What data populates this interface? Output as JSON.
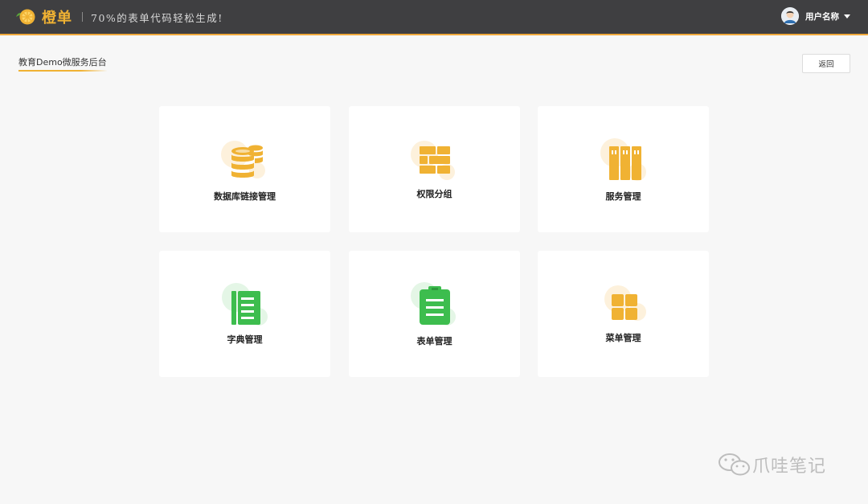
{
  "header": {
    "logo_text": "橙单",
    "slogan": "70%的表单代码轻松生成!",
    "user_name": "用户名称"
  },
  "page": {
    "title": "教育Demo微服务后台",
    "back_label": "返回"
  },
  "cards": [
    {
      "label": "数据库链接管理",
      "icon": "database-icon",
      "color": "#f0b233"
    },
    {
      "label": "权限分组",
      "icon": "brick-wall-icon",
      "color": "#f0b233"
    },
    {
      "label": "服务管理",
      "icon": "server-rack-icon",
      "color": "#f0b233"
    },
    {
      "label": "字典管理",
      "icon": "notebook-icon",
      "color": "#3dbd4e"
    },
    {
      "label": "表单管理",
      "icon": "clipboard-icon",
      "color": "#3dbd4e"
    },
    {
      "label": "菜单管理",
      "icon": "grid-menu-icon",
      "color": "#f0b233"
    }
  ],
  "watermark": {
    "text": "爪哇笔记"
  },
  "colors": {
    "topbar": "#3f3f41",
    "accent_orange": "#f0b233",
    "accent_green": "#3dbd4e",
    "background": "#f7f7f7"
  }
}
